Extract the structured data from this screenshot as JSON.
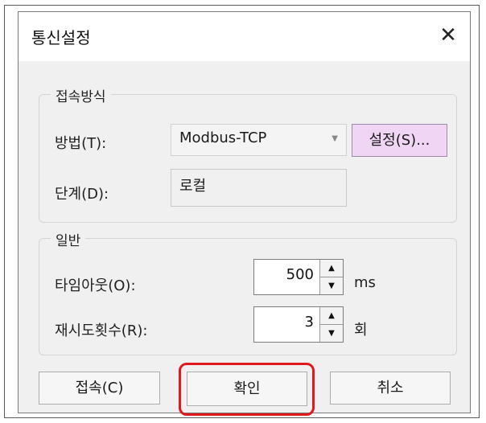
{
  "dialog": {
    "title": "통신설정",
    "close_icon": "✕"
  },
  "connection_group": {
    "legend": "접속방식",
    "method_label": "방법(T):",
    "method_value": "Modbus-TCP",
    "dropdown_icon": "chevron-down-icon",
    "setup_button_label": "설정(S)...",
    "stage_label": "단계(D):",
    "stage_value": "로컬"
  },
  "general_group": {
    "legend": "일반",
    "timeout_label": "타임아웃(O):",
    "timeout_value": "500",
    "timeout_unit": "ms",
    "retry_label": "재시도횟수(R):",
    "retry_value": "3",
    "retry_unit": "회"
  },
  "buttons": {
    "connect_label": "접속(C)",
    "ok_label": "확인",
    "cancel_label": "취소"
  },
  "colors": {
    "setup_button_bg": "#f0d6f4",
    "highlight_border": "#e0191f"
  }
}
